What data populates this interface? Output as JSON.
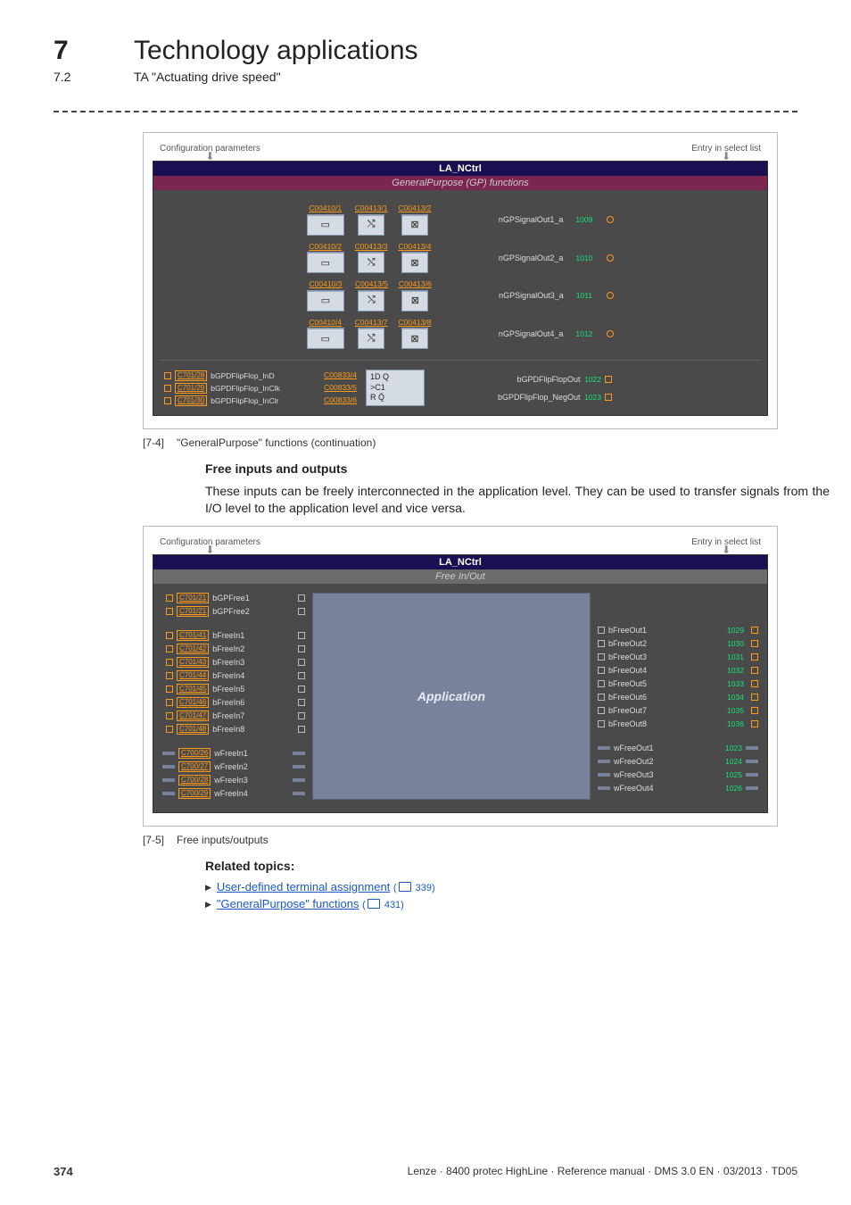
{
  "header": {
    "chapter_number": "7",
    "chapter_title": "Technology applications",
    "section_number": "7.2",
    "section_title": "TA \"Actuating drive speed\""
  },
  "diagram1": {
    "top_left_label": "Configuration parameters",
    "top_right_label": "Entry in select list",
    "titlebar": "LA_NCtrl",
    "sectionbar": "GeneralPurpose (GP) functions",
    "rows": [
      {
        "p1": "C00410/1",
        "p2": "C00413/1",
        "p3": "C00413/2",
        "out": "nGPSignalOut1_a",
        "port": "1009"
      },
      {
        "p1": "C00410/2",
        "p2": "C00413/3",
        "p3": "C00413/4",
        "out": "nGPSignalOut2_a",
        "port": "1010"
      },
      {
        "p1": "C00410/3",
        "p2": "C00413/5",
        "p3": "C00413/6",
        "out": "nGPSignalOut3_a",
        "port": "1011"
      },
      {
        "p1": "C00410/4",
        "p2": "C00413/7",
        "p3": "C00413/8",
        "out": "nGPSignalOut4_a",
        "port": "1012"
      }
    ],
    "flipflop": {
      "inputs": [
        {
          "port": "C701/28",
          "label": "bGPDFlipFlop_InD",
          "param": "C00833/4"
        },
        {
          "port": "C701/29",
          "label": "bGPDFlipFlop_InClk",
          "param": "C00833/5"
        },
        {
          "port": "C701/30",
          "label": "bGPDFlipFlop_InClr",
          "param": "C00833/6"
        }
      ],
      "box_lines": [
        "1D  Q",
        ">C1",
        "R    Q̄"
      ],
      "outputs": [
        {
          "label": "bGPDFlipFlopOut",
          "port": "1022"
        },
        {
          "label": "bGPDFlipFlop_NegOut",
          "port": "1023"
        }
      ]
    }
  },
  "caption1": {
    "tag": "[7-4]",
    "text": "\"GeneralPurpose\" functions (continuation)"
  },
  "section": {
    "heading": "Free inputs and outputs",
    "paragraph": "These inputs can be freely interconnected in the application level. They can be used to transfer signals from the I/O level to the application level and vice versa."
  },
  "diagram2": {
    "top_left_label": "Configuration parameters",
    "top_right_label": "Entry in select list",
    "titlebar": "LA_NCtrl",
    "sectionbar": "Free In/Out",
    "center": "Application",
    "left_group1": [
      {
        "port": "C701/21",
        "label": "bGPFree1"
      },
      {
        "port": "C701/21",
        "label": "bGPFree2"
      }
    ],
    "left_group2": [
      {
        "port": "C701/41",
        "label": "bFreeIn1"
      },
      {
        "port": "C701/42",
        "label": "bFreeIn2"
      },
      {
        "port": "C701/43",
        "label": "bFreeIn3"
      },
      {
        "port": "C701/44",
        "label": "bFreeIn4"
      },
      {
        "port": "C701/45",
        "label": "bFreeIn5"
      },
      {
        "port": "C701/46",
        "label": "bFreeIn6"
      },
      {
        "port": "C701/47",
        "label": "bFreeIn7"
      },
      {
        "port": "C701/48",
        "label": "bFreeIn8"
      }
    ],
    "left_group3": [
      {
        "port": "C700/26",
        "label": "wFreeIn1"
      },
      {
        "port": "C700/27",
        "label": "wFreeIn2"
      },
      {
        "port": "C700/28",
        "label": "wFreeIn3"
      },
      {
        "port": "C700/29",
        "label": "wFreeIn4"
      }
    ],
    "right_group1": [
      {
        "label": "bFreeOut1",
        "port": "1029"
      },
      {
        "label": "bFreeOut2",
        "port": "1030"
      },
      {
        "label": "bFreeOut3",
        "port": "1031"
      },
      {
        "label": "bFreeOut4",
        "port": "1032"
      },
      {
        "label": "bFreeOut5",
        "port": "1033"
      },
      {
        "label": "bFreeOut6",
        "port": "1034"
      },
      {
        "label": "bFreeOut7",
        "port": "1035"
      },
      {
        "label": "bFreeOut8",
        "port": "1036"
      }
    ],
    "right_group2": [
      {
        "label": "wFreeOut1",
        "port": "1023"
      },
      {
        "label": "wFreeOut2",
        "port": "1024"
      },
      {
        "label": "wFreeOut3",
        "port": "1025"
      },
      {
        "label": "wFreeOut4",
        "port": "1026"
      }
    ]
  },
  "caption2": {
    "tag": "[7-5]",
    "text": "Free inputs/outputs"
  },
  "related": {
    "heading": "Related topics:",
    "links": [
      {
        "text": "User-defined terminal assignment",
        "page": "339"
      },
      {
        "text": "\"GeneralPurpose\" functions",
        "page": "431"
      }
    ]
  },
  "footer": {
    "page": "374",
    "doc": "Lenze · 8400 protec HighLine · Reference manual · DMS 3.0 EN · 03/2013 · TD05"
  }
}
